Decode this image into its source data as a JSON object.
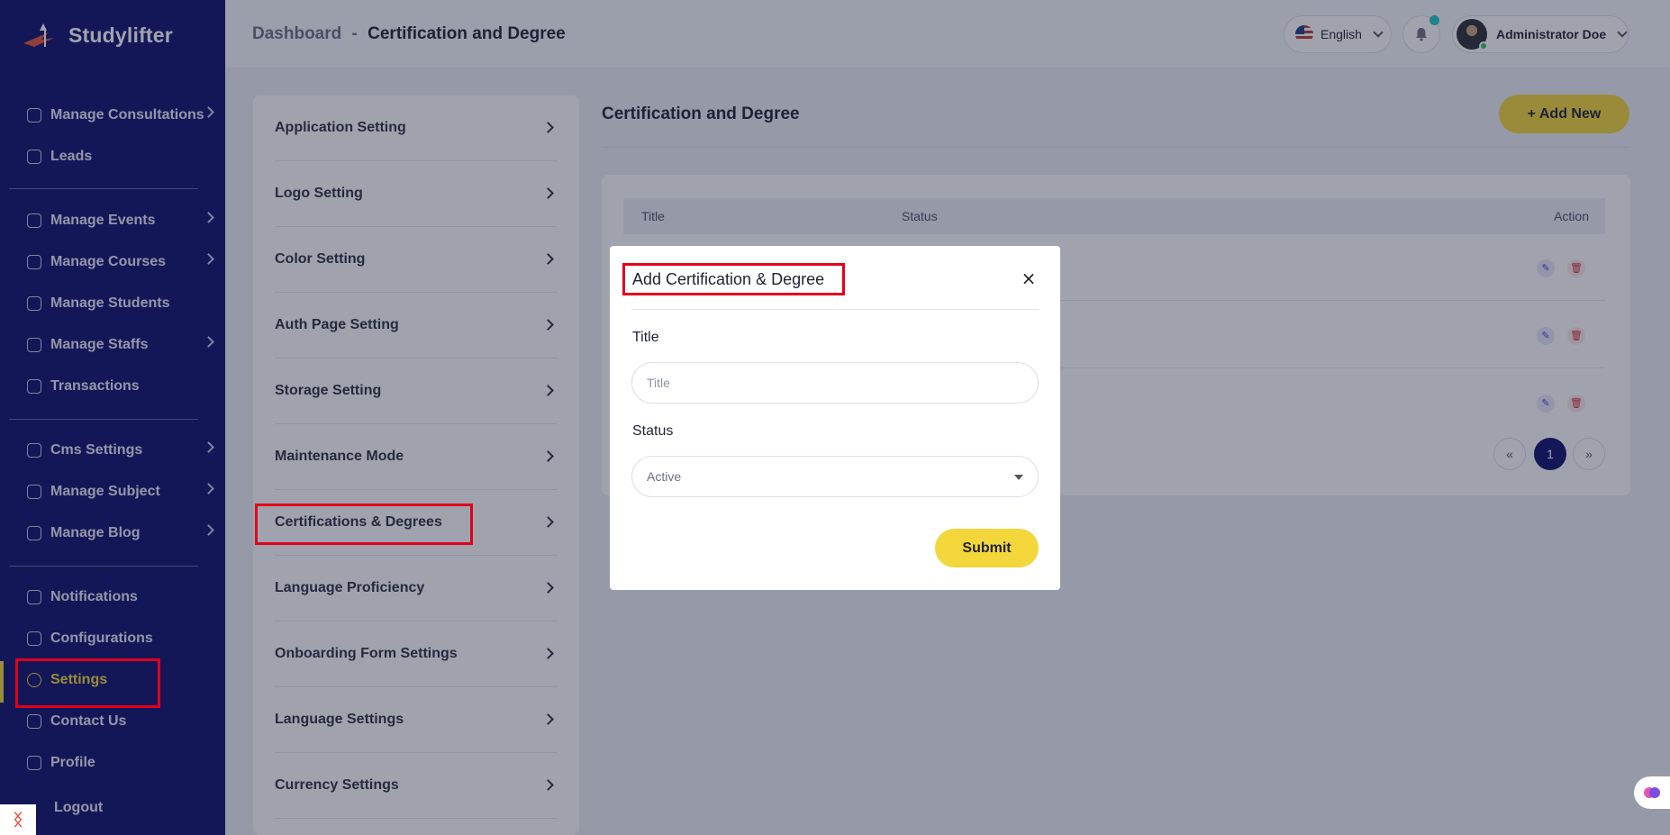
{
  "app": {
    "brand": "Studylifter"
  },
  "sidebar": {
    "items": [
      {
        "label": "Manage Consultations",
        "chevron": true
      },
      {
        "label": "Leads",
        "chevron": false
      },
      {
        "label": "Manage Events",
        "chevron": true
      },
      {
        "label": "Manage Courses",
        "chevron": true
      },
      {
        "label": "Manage Students",
        "chevron": false
      },
      {
        "label": "Manage Staffs",
        "chevron": true
      },
      {
        "label": "Transactions",
        "chevron": false
      },
      {
        "label": "Cms Settings",
        "chevron": true
      },
      {
        "label": "Manage Subject",
        "chevron": true
      },
      {
        "label": "Manage Blog",
        "chevron": true
      },
      {
        "label": "Notifications",
        "chevron": false
      },
      {
        "label": "Configurations",
        "chevron": false
      },
      {
        "label": "Settings",
        "chevron": false,
        "active": true
      },
      {
        "label": "Contact Us",
        "chevron": false
      },
      {
        "label": "Profile",
        "chevron": false
      },
      {
        "label": "Logout",
        "chevron": false
      }
    ]
  },
  "header": {
    "breadcrumb_root": "Dashboard",
    "breadcrumb_sep": "-",
    "breadcrumb_current": "Certification and Degree",
    "language": "English",
    "user_name": "Administrator Doe"
  },
  "settings_menu": {
    "items": [
      "Application Setting",
      "Logo Setting",
      "Color Setting",
      "Auth Page Setting",
      "Storage Setting",
      "Maintenance Mode",
      "Certifications & Degrees",
      "Language Proficiency",
      "Onboarding Form Settings",
      "Language Settings",
      "Currency Settings"
    ],
    "active": "Certifications & Degrees"
  },
  "main": {
    "title": "Certification and Degree",
    "add_button": "+ Add New",
    "table": {
      "columns": [
        "Title",
        "Status",
        "Action"
      ]
    },
    "pagination": {
      "prev": "«",
      "current": "1",
      "next": "»"
    }
  },
  "modal": {
    "title": "Add Certification & Degree",
    "close": "×",
    "title_label": "Title",
    "title_placeholder": "Title",
    "status_label": "Status",
    "status_value": "Active",
    "submit": "Submit"
  },
  "colors": {
    "sidebar_bg": "#0f0e6b",
    "accent": "#f3d63a",
    "highlight": "#e3001b"
  }
}
